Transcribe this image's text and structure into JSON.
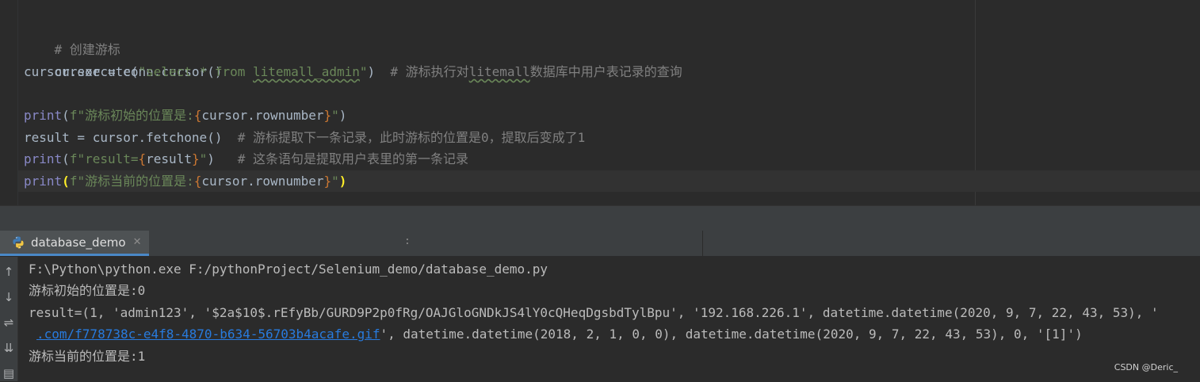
{
  "editor": {
    "lines": {
      "l1": "# 创建游标",
      "l2": "cursor = conn.cursor()",
      "l3_a": "cursor.execute(",
      "l3_s1": "\"select * from ",
      "l3_s2": "litemall_admin",
      "l3_s3": "\"",
      "l3_b": ")  ",
      "l3_c1": "# 游标执行对",
      "l3_c2": "litemall",
      "l3_c3": "数据库中用户表记录的查询",
      "l5_func": "print",
      "l5_a": "(",
      "l5_f": "f\"游标初始的位置是:",
      "l5_ob": "{",
      "l5_expr": "cursor.rownumber",
      "l5_cb": "}",
      "l5_q": "\"",
      "l5_b": ")",
      "l6_code": "result = cursor.fetchone()  ",
      "l6_comment": "# 游标提取下一条记录，此时游标的位置是0，提取后变成了1",
      "l7_func": "print",
      "l7_a": "(",
      "l7_f": "f\"result=",
      "l7_ob": "{",
      "l7_expr": "result",
      "l7_cb": "}",
      "l7_q": "\"",
      "l7_b": ")   ",
      "l7_comment": "# 这条语句是提取用户表里的第一条记录",
      "l8_func": "print",
      "l8_a": "(",
      "l8_f": "f\"游标当前的位置是:",
      "l8_ob": "{",
      "l8_expr": "cursor.rownumber",
      "l8_cb": "}",
      "l8_q": "\"",
      "l8_b": ")"
    }
  },
  "run_panel": {
    "tab_label": "database_demo",
    "close_glyph": "✕",
    "divider_glyph": ":",
    "toolbar": {
      "up": "↑",
      "down": "↓",
      "wrap": "⇌",
      "scroll_end": "⇊",
      "print": "▤"
    }
  },
  "console": {
    "line1": "F:\\Python\\python.exe F:/pythonProject/Selenium_demo/database_demo.py",
    "line2": "游标初始的位置是:0",
    "line3": "result=(1, 'admin123', '$2a$10$.rEfyBb/GURD9P2p0fRg/OAJGloGNDkJS4lY0cQHeqDgsbdTylBpu', '192.168.226.1', datetime.datetime(2020, 9, 7, 22, 43, 53), '",
    "line4_link": ".com/f778738c-e4f8-4870-b634-56703b4acafe.gif",
    "line4_rest": "', datetime.datetime(2018, 2, 1, 0, 0), datetime.datetime(2020, 9, 7, 22, 43, 53), 0, '[1]')",
    "line5": "游标当前的位置是:1"
  },
  "watermark": "CSDN @Deric_",
  "colors": {
    "background": "#2b2b2b",
    "comment": "#808080",
    "string": "#6a8759",
    "builtin": "#8888c6",
    "brace": "#cc7832",
    "link": "#287bde",
    "tab_accent": "#4a88c7"
  }
}
